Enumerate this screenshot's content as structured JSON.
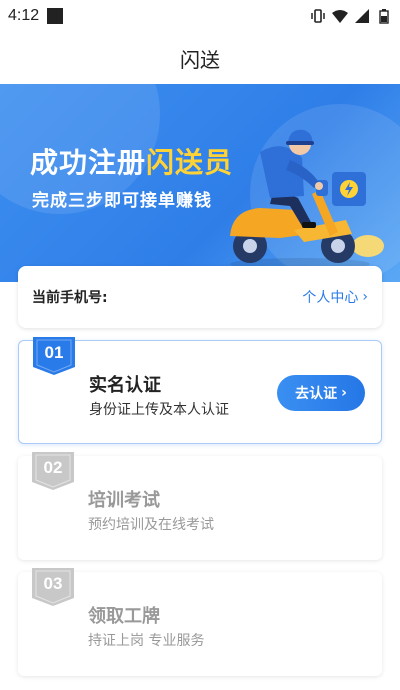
{
  "status_bar": {
    "time": "4:12"
  },
  "app_bar": {
    "title": "闪送"
  },
  "banner": {
    "title_part1": "成功注册",
    "title_highlight": "闪送员",
    "subtitle": "完成三步即可接单赚钱"
  },
  "phone_card": {
    "label": "当前手机号:",
    "link_label": "个人中心",
    "link_chevron": "›"
  },
  "steps": [
    {
      "number": "01",
      "title": "实名认证",
      "desc": "身份证上传及本人认证",
      "button": "去认证",
      "chevron": "›"
    },
    {
      "number": "02",
      "title": "培训考试",
      "desc": "预约培训及在线考试"
    },
    {
      "number": "03",
      "title": "领取工牌",
      "desc": "持证上岗 专业服务"
    }
  ],
  "colors": {
    "accent": "#2a7bea",
    "highlight": "#ffd335",
    "inactive": "#999999"
  }
}
